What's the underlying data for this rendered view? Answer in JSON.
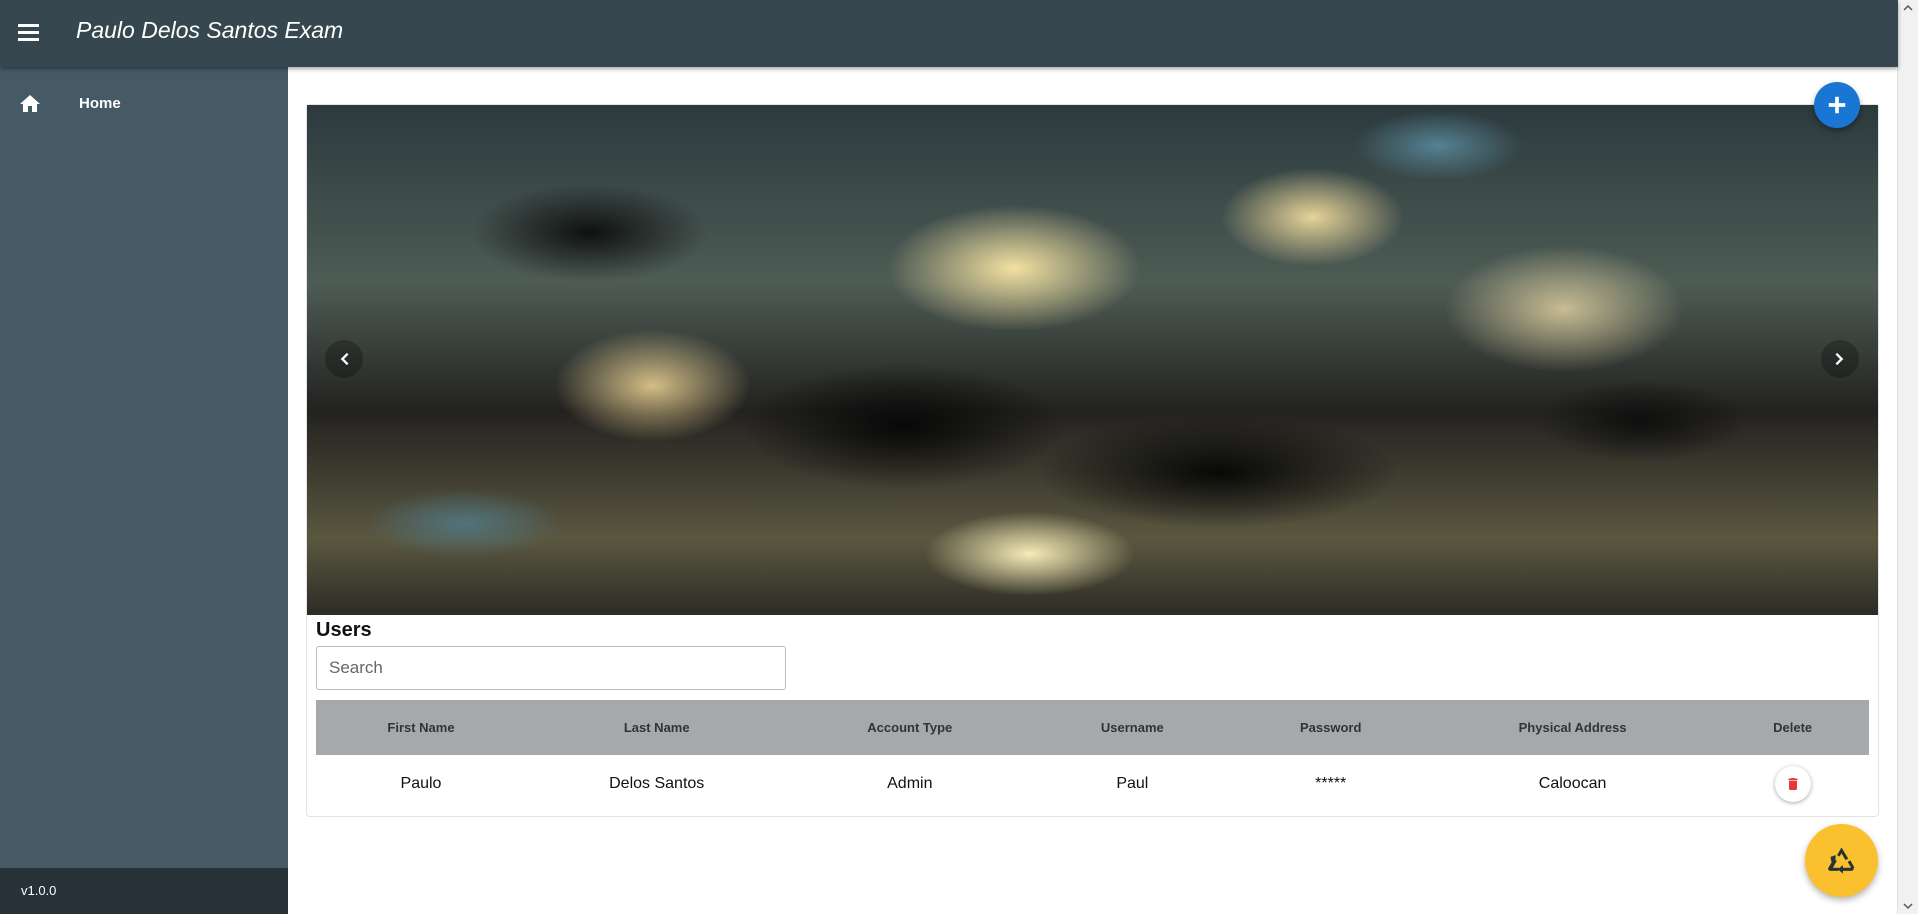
{
  "app": {
    "title": "Paulo Delos Santos Exam",
    "menu_icon": "menu-icon"
  },
  "sidebar": {
    "items": [
      {
        "label": "Home",
        "icon": "home-icon"
      }
    ],
    "version": "v1.0.0"
  },
  "carousel": {
    "prev_icon": "chevron-left-icon",
    "next_icon": "chevron-right-icon"
  },
  "actions": {
    "add_icon": "plus-icon",
    "recycle_icon": "recycle-icon"
  },
  "users": {
    "title": "Users",
    "search": {
      "placeholder": "Search",
      "value": ""
    },
    "columns": [
      "First Name",
      "Last Name",
      "Account Type",
      "Username",
      "Password",
      "Physical Address",
      "Delete"
    ],
    "rows": [
      [
        "Paulo",
        "Delos Santos",
        "Admin",
        "Paul",
        "*****",
        "Caloocan"
      ]
    ],
    "delete_icon": "trash-icon"
  },
  "colors": {
    "topbar": "#37474f",
    "sidebar": "#455a64",
    "version_bar": "#263238",
    "add_fab": "#1976d2",
    "recycle_fab": "#fbc02d",
    "delete_icon": "#e53935",
    "table_header": "#a6a9ac"
  }
}
